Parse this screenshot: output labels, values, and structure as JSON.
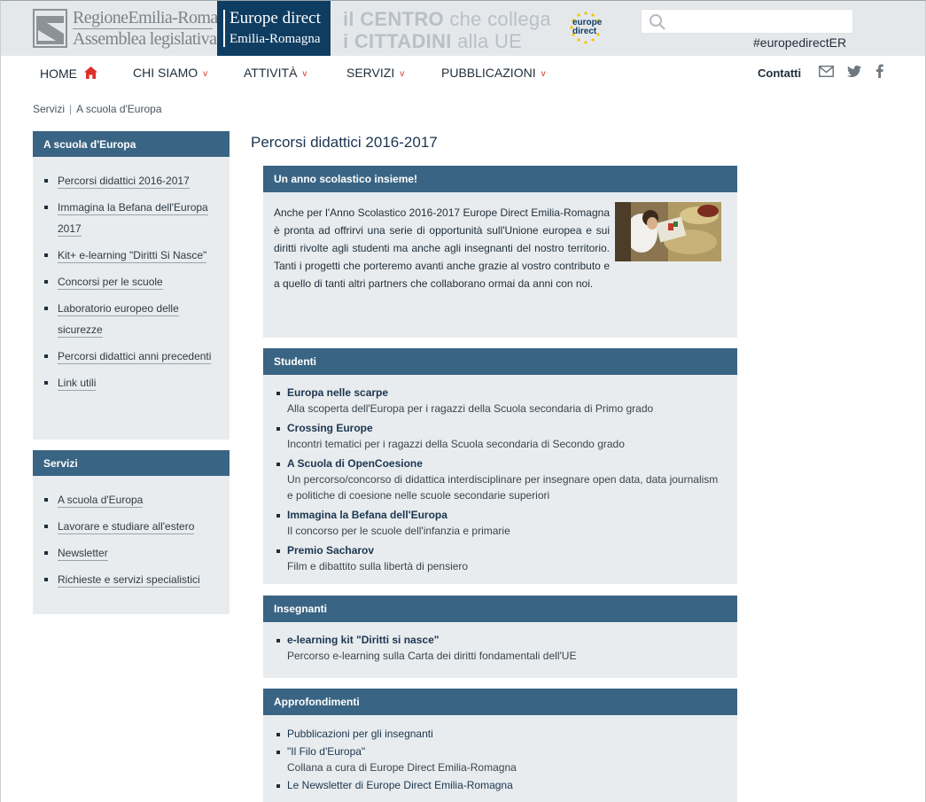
{
  "header": {
    "logo_rer_line1": "RegioneEmilia-Romagna",
    "logo_rer_line2": "Assemblea legislativa",
    "logo_ed_line1": "Europe direct",
    "logo_ed_line2": "Emilia-Romagna",
    "slogan_line1_bold": "il CENTRO",
    "slogan_line1_rest": " che collega",
    "slogan_line2_bold": "i CITTADINI",
    "slogan_line2_rest": " alla UE",
    "eu_logo_line1": "europe",
    "eu_logo_line2": "direct",
    "search_placeholder": "",
    "hashtag": "#europedirectER"
  },
  "nav": {
    "items": [
      {
        "label": "HOME"
      },
      {
        "label": "CHI SIAMO"
      },
      {
        "label": "ATTIVITÀ"
      },
      {
        "label": "SERVIZI"
      },
      {
        "label": "PUBBLICAZIONI"
      }
    ],
    "chevron": "v",
    "contatti": "Contatti"
  },
  "breadcrumb": {
    "items": [
      "Servizi",
      "A scuola d'Europa"
    ],
    "separator": "|"
  },
  "sidebar": {
    "box1": {
      "title": "A scuola d'Europa",
      "items": [
        "Percorsi didattici 2016-2017",
        "Immagina la Befana dell'Europa 2017",
        "Kit+ e-learning \"Diritti Si Nasce\"",
        "Concorsi per le scuole",
        "Laboratorio europeo delle sicurezze",
        "Percorsi didattici anni precedenti",
        "Link utili"
      ]
    },
    "box2": {
      "title": "Servizi",
      "items": [
        "A scuola d'Europa",
        "Lavorare e studiare all'estero",
        "Newsletter",
        "Richieste e servizi specialistici"
      ]
    }
  },
  "main": {
    "title": "Percorsi didattici 2016-2017",
    "intro": {
      "title": "Un anno scolastico insieme!",
      "text": "Anche per l'Anno Scolastico 2016-2017 Europe Direct Emilia-Romagna è pronta ad offrirvi una serie di opportunità sull'Unione europea e sui diritti rivolte agli studenti ma anche agli insegnanti del nostro territorio. Tanti i progetti che porteremo avanti anche grazie al vostro contributo e a quello di tanti altri partners che collaborano ormai da anni con noi."
    },
    "studenti": {
      "title": "Studenti",
      "items": [
        {
          "title": "Europa nelle scarpe",
          "desc": "Alla scoperta dell'Europa per i ragazzi della Scuola secondaria di Primo grado"
        },
        {
          "title": "Crossing Europe",
          "desc": "Incontri tematici per i ragazzi della Scuola secondaria di Secondo grado"
        },
        {
          "title": "A Scuola di OpenCoesione",
          "desc": "Un percorso/concorso di didattica interdisciplinare per insegnare open data, data journalism e politiche di coesione nelle scuole secondarie superiori"
        },
        {
          "title": "Immagina la Befana dell'Europa",
          "desc": "Il concorso per le scuole dell'infanzia e primarie"
        },
        {
          "title": "Premio Sacharov",
          "desc": "Film e dibattito sulla libertà di pensiero"
        }
      ]
    },
    "insegnanti": {
      "title": "Insegnanti",
      "items": [
        {
          "title": "e-learning kit \"Diritti si nasce\"",
          "desc": "Percorso e-learning sulla Carta dei diritti fondamentali dell'UE"
        }
      ]
    },
    "approfondimenti": {
      "title": "Approfondimenti",
      "items": [
        {
          "title": "Pubblicazioni per gli insegnanti",
          "desc": ""
        },
        {
          "title": "\"Il Filo d'Europa\"",
          "desc": "Collana a cura di Europe Direct Emilia-Romagna"
        },
        {
          "title": "Le Newsletter di Europe Direct Emilia-Romagna",
          "desc": ""
        }
      ]
    }
  },
  "colors": {
    "brand_dark": "#0f3d62",
    "panel_header": "#3a6483",
    "panel_bg": "#e8ecee",
    "accent_red": "#d9322b"
  },
  "icons": [
    "home-icon",
    "search-icon",
    "mail-icon",
    "twitter-icon",
    "facebook-icon",
    "eu-stars-icon"
  ]
}
